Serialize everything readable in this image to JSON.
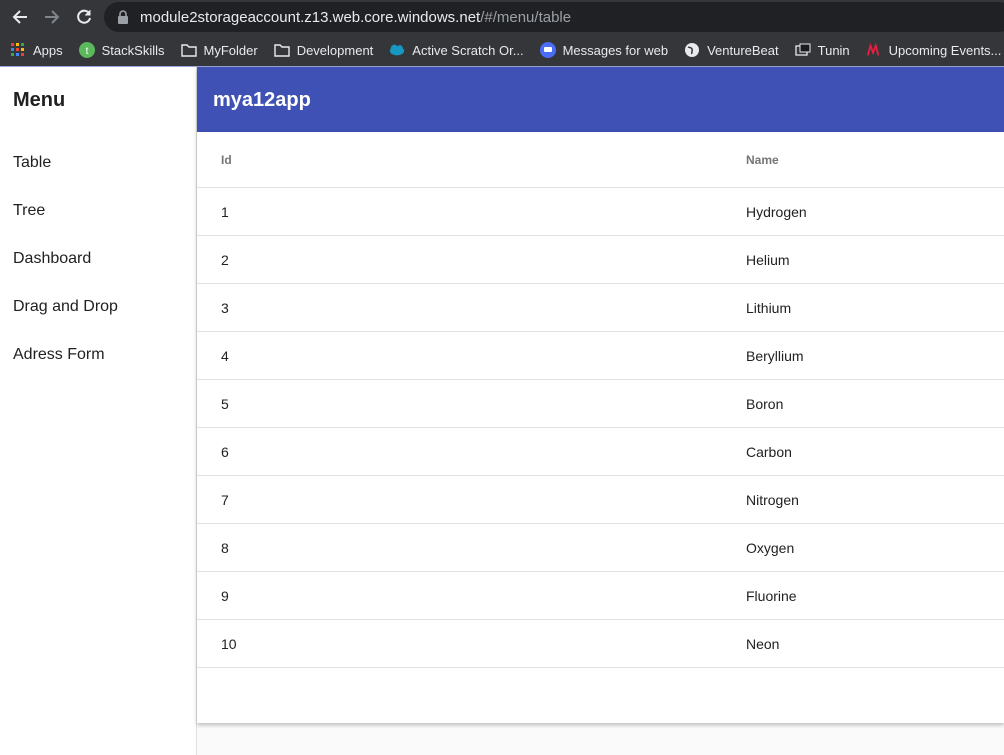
{
  "browser": {
    "url_host": "module2storageaccount.z13.web.core.windows.net",
    "url_path": "/#/menu/table",
    "bookmarks": [
      {
        "label": "Apps",
        "icon": "apps-grid-icon"
      },
      {
        "label": "StackSkills",
        "icon": "stackskills-icon"
      },
      {
        "label": "MyFolder",
        "icon": "folder-icon"
      },
      {
        "label": "Development",
        "icon": "folder-icon"
      },
      {
        "label": "Active Scratch Or...",
        "icon": "salesforce-cloud-icon"
      },
      {
        "label": "Messages for web",
        "icon": "messages-icon"
      },
      {
        "label": "VentureBeat",
        "icon": "globe-icon"
      },
      {
        "label": "Tunin",
        "icon": "tunein-icon"
      },
      {
        "label": "Upcoming Events...",
        "icon": "meetup-icon"
      }
    ]
  },
  "sidebar": {
    "title": "Menu",
    "items": [
      {
        "label": "Table"
      },
      {
        "label": "Tree"
      },
      {
        "label": "Dashboard"
      },
      {
        "label": "Drag and Drop"
      },
      {
        "label": "Adress Form"
      }
    ]
  },
  "toolbar": {
    "title": "mya12app"
  },
  "table": {
    "headers": {
      "id": "Id",
      "name": "Name"
    },
    "rows": [
      {
        "id": "1",
        "name": "Hydrogen"
      },
      {
        "id": "2",
        "name": "Helium"
      },
      {
        "id": "3",
        "name": "Lithium"
      },
      {
        "id": "4",
        "name": "Beryllium"
      },
      {
        "id": "5",
        "name": "Boron"
      },
      {
        "id": "6",
        "name": "Carbon"
      },
      {
        "id": "7",
        "name": "Nitrogen"
      },
      {
        "id": "8",
        "name": "Oxygen"
      },
      {
        "id": "9",
        "name": "Fluorine"
      },
      {
        "id": "10",
        "name": "Neon"
      }
    ]
  },
  "colors": {
    "primary": "#3f51b5",
    "chrome": "#35363a",
    "urlbar": "#202124"
  }
}
